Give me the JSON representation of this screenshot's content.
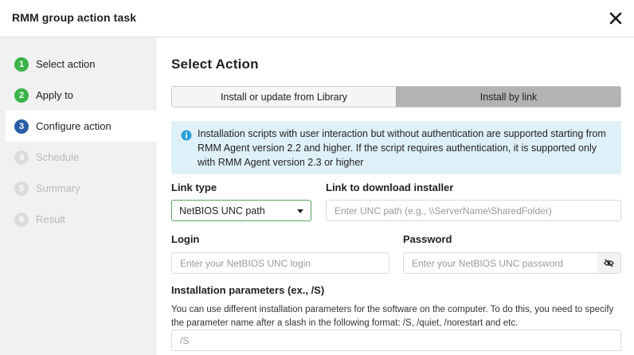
{
  "window": {
    "title": "RMM group action task"
  },
  "steps": [
    {
      "num": "1",
      "label": "Select action",
      "state": "done"
    },
    {
      "num": "2",
      "label": "Apply to",
      "state": "done"
    },
    {
      "num": "3",
      "label": "Configure action",
      "state": "current"
    },
    {
      "num": "4",
      "label": "Schedule",
      "state": "pending"
    },
    {
      "num": "5",
      "label": "Summary",
      "state": "pending"
    },
    {
      "num": "6",
      "label": "Result",
      "state": "pending"
    }
  ],
  "main": {
    "title": "Select Action",
    "tabs": [
      {
        "label": "Install or update from Library",
        "selected": false
      },
      {
        "label": "Install by link",
        "selected": true
      }
    ],
    "info": "Installation scripts with user interaction but without authentication are supported starting from RMM Agent version 2.2 and higher. If the script requires authentication, it is supported only with RMM Agent version 2.3 or higher",
    "link_type": {
      "label": "Link type",
      "value": "NetBIOS UNC path"
    },
    "download": {
      "label": "Link to download installer",
      "placeholder": "Enter UNC path (e.g., \\\\ServerName\\SharedFolder)"
    },
    "login": {
      "label": "Login",
      "placeholder": "Enter your NetBIOS UNC login"
    },
    "password": {
      "label": "Password",
      "placeholder": "Enter your NetBIOS UNC password"
    },
    "params": {
      "label": "Installation parameters (ex., /S)",
      "help": "You can use different installation parameters for the software on the computer. To do this, you need to specify the parameter name after a slash in the following format: /S, /quiet, /norestart and etc.",
      "placeholder": "/S"
    }
  },
  "colors": {
    "done": "#3bb349",
    "current": "#2a5ca8",
    "info_bg": "#dff1f8",
    "select_border": "#5aa55e"
  }
}
